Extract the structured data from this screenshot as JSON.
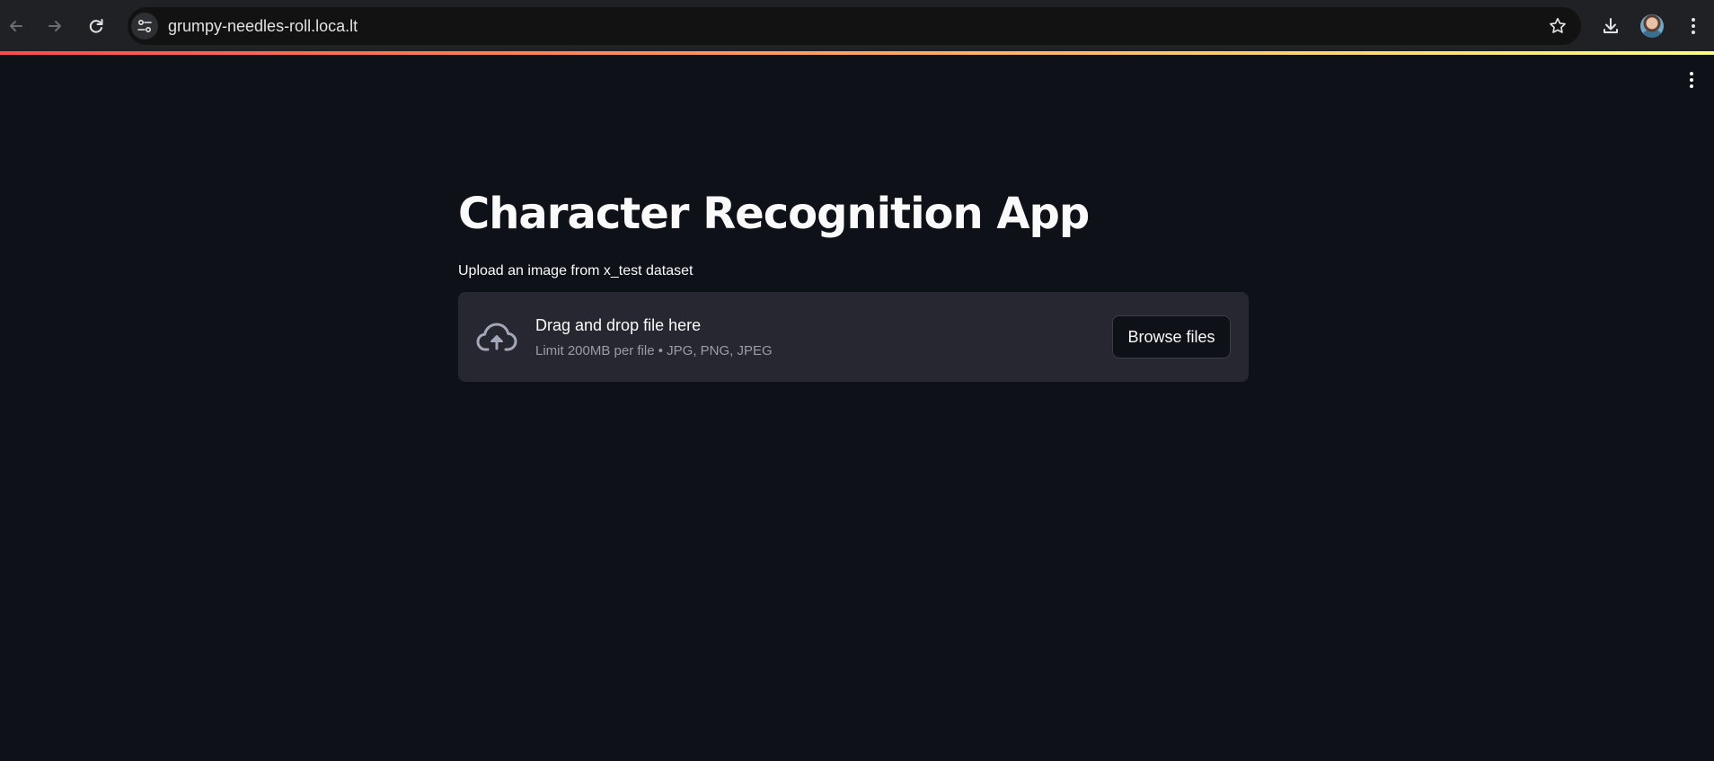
{
  "browser": {
    "url": "grumpy-needles-roll.loca.lt",
    "icons": {
      "back": "arrow-left-icon",
      "forward": "arrow-right-icon",
      "reload": "reload-icon",
      "site_info": "tune-icon",
      "bookmark": "star-icon",
      "download": "download-icon",
      "profile": "avatar",
      "menu": "kebab-menu-icon"
    }
  },
  "app": {
    "title": "Character Recognition App",
    "uploader": {
      "label": "Upload an image from x_test dataset",
      "drop_text": "Drag and drop file here",
      "limit_text": "Limit 200MB per file • JPG, PNG, JPEG",
      "browse_label": "Browse files",
      "icon": "cloud-upload-icon"
    },
    "menu_icon": "kebab-menu-icon"
  },
  "colors": {
    "background": "#0e1117",
    "surface": "#262730",
    "text": "#fafafa",
    "muted_text": "#9a9ca6",
    "accent_gradient_start": "#ff4b4b",
    "accent_gradient_end": "#fffd80",
    "chrome_bar": "#202124"
  }
}
